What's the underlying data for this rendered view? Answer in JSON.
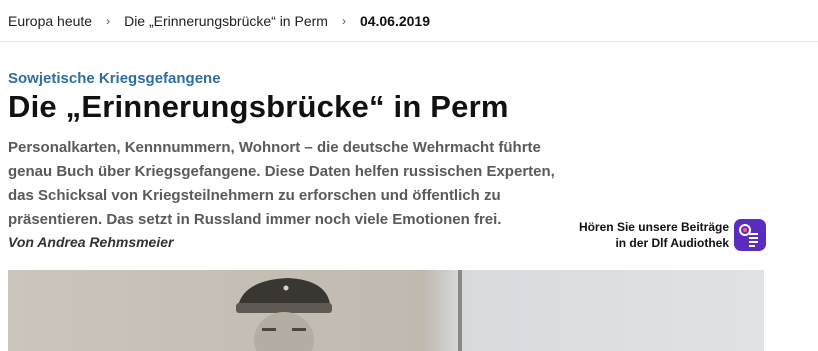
{
  "breadcrumb": {
    "items": [
      "Europa heute",
      "Die „Erinnerungsbrücke“ in Perm"
    ],
    "current": "04.06.2019"
  },
  "article": {
    "kicker": "Sowjetische Kriegsgefangene",
    "headline": "Die „Erinnerungsbrücke“ in Perm",
    "teaser": "Personalkarten, Kennnummern, Wohnort – die deutsche Wehrmacht führte genau Buch über Kriegsgefangene. Diese Daten helfen russischen Experten, das Schicksal von Kriegsteilnehmern zu erforschen und öffentlich zu präsentieren. Das setzt in Russland immer noch viele Emotionen frei.",
    "author": "Von Andrea Rehmsmeier"
  },
  "promo": {
    "line1": "Hören Sie unsere Beiträge",
    "line2": "in der Dlf Audiothek",
    "icon": "dlf-audiothek-app-icon"
  },
  "colors": {
    "kicker": "#2f6e9f",
    "app_icon": "#5b2dbf"
  }
}
